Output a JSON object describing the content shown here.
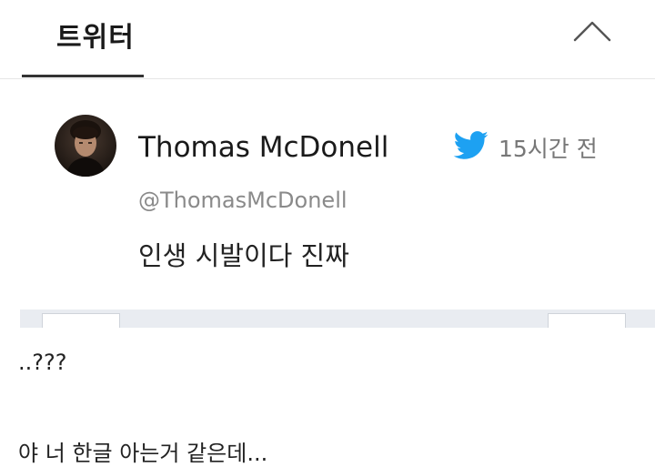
{
  "header": {
    "tab_title": "트위터"
  },
  "tweet": {
    "author_name": "Thomas McDonell",
    "handle": "@ThomasMcDonell",
    "time_ago": "15시간 전",
    "text": "인생 시발이다 진짜"
  },
  "comments": [
    "..???",
    "야 너 한글 아는거 같은데..."
  ],
  "icons": {
    "collapse": "chevron-up-icon",
    "source": "twitter-bird-icon"
  },
  "colors": {
    "twitter_blue": "#1da1f2",
    "time_gray": "#777777",
    "handle_gray": "#8a8a8a"
  }
}
